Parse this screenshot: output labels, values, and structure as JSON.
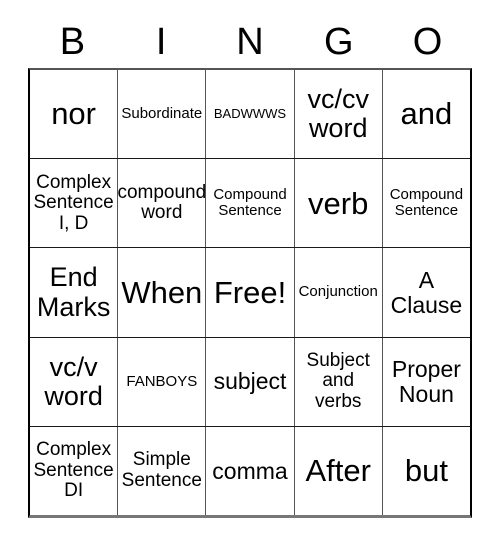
{
  "card": {
    "headers": [
      "B",
      "I",
      "N",
      "G",
      "O"
    ],
    "free_space_label": "Free!",
    "colors": {
      "border": "#000000",
      "grid_line": "#555555",
      "text": "#000000",
      "background": "#ffffff"
    },
    "rows": [
      [
        {
          "text": "nor",
          "size": "fs-xxl"
        },
        {
          "text": "Subordinate",
          "size": "fs-s"
        },
        {
          "text": "BADWWWS",
          "size": "fs-xs"
        },
        {
          "text": "vc/cv word",
          "size": "fs-xl"
        },
        {
          "text": "and",
          "size": "fs-xxl"
        }
      ],
      [
        {
          "text": "Complex Sentence I, D",
          "size": "fs-m"
        },
        {
          "text": "compound word",
          "size": "fs-m"
        },
        {
          "text": "Compound Sentence",
          "size": "fs-s"
        },
        {
          "text": "verb",
          "size": "fs-xxl"
        },
        {
          "text": "Compound Sentence",
          "size": "fs-s"
        }
      ],
      [
        {
          "text": "End Marks",
          "size": "fs-xl"
        },
        {
          "text": "When",
          "size": "fs-xxl"
        },
        {
          "text": "Free!",
          "size": "fs-xxl"
        },
        {
          "text": "Conjunction",
          "size": "fs-s"
        },
        {
          "text": "A Clause",
          "size": "fs-l"
        }
      ],
      [
        {
          "text": "vc/v word",
          "size": "fs-xl"
        },
        {
          "text": "FANBOYS",
          "size": "fs-s"
        },
        {
          "text": "subject",
          "size": "fs-l"
        },
        {
          "text": "Subject and verbs",
          "size": "fs-m"
        },
        {
          "text": "Proper Noun",
          "size": "fs-l"
        }
      ],
      [
        {
          "text": "Complex Sentence DI",
          "size": "fs-m"
        },
        {
          "text": "Simple Sentence",
          "size": "fs-m"
        },
        {
          "text": "comma",
          "size": "fs-l"
        },
        {
          "text": "After",
          "size": "fs-xxl"
        },
        {
          "text": "but",
          "size": "fs-xxl"
        }
      ]
    ]
  }
}
